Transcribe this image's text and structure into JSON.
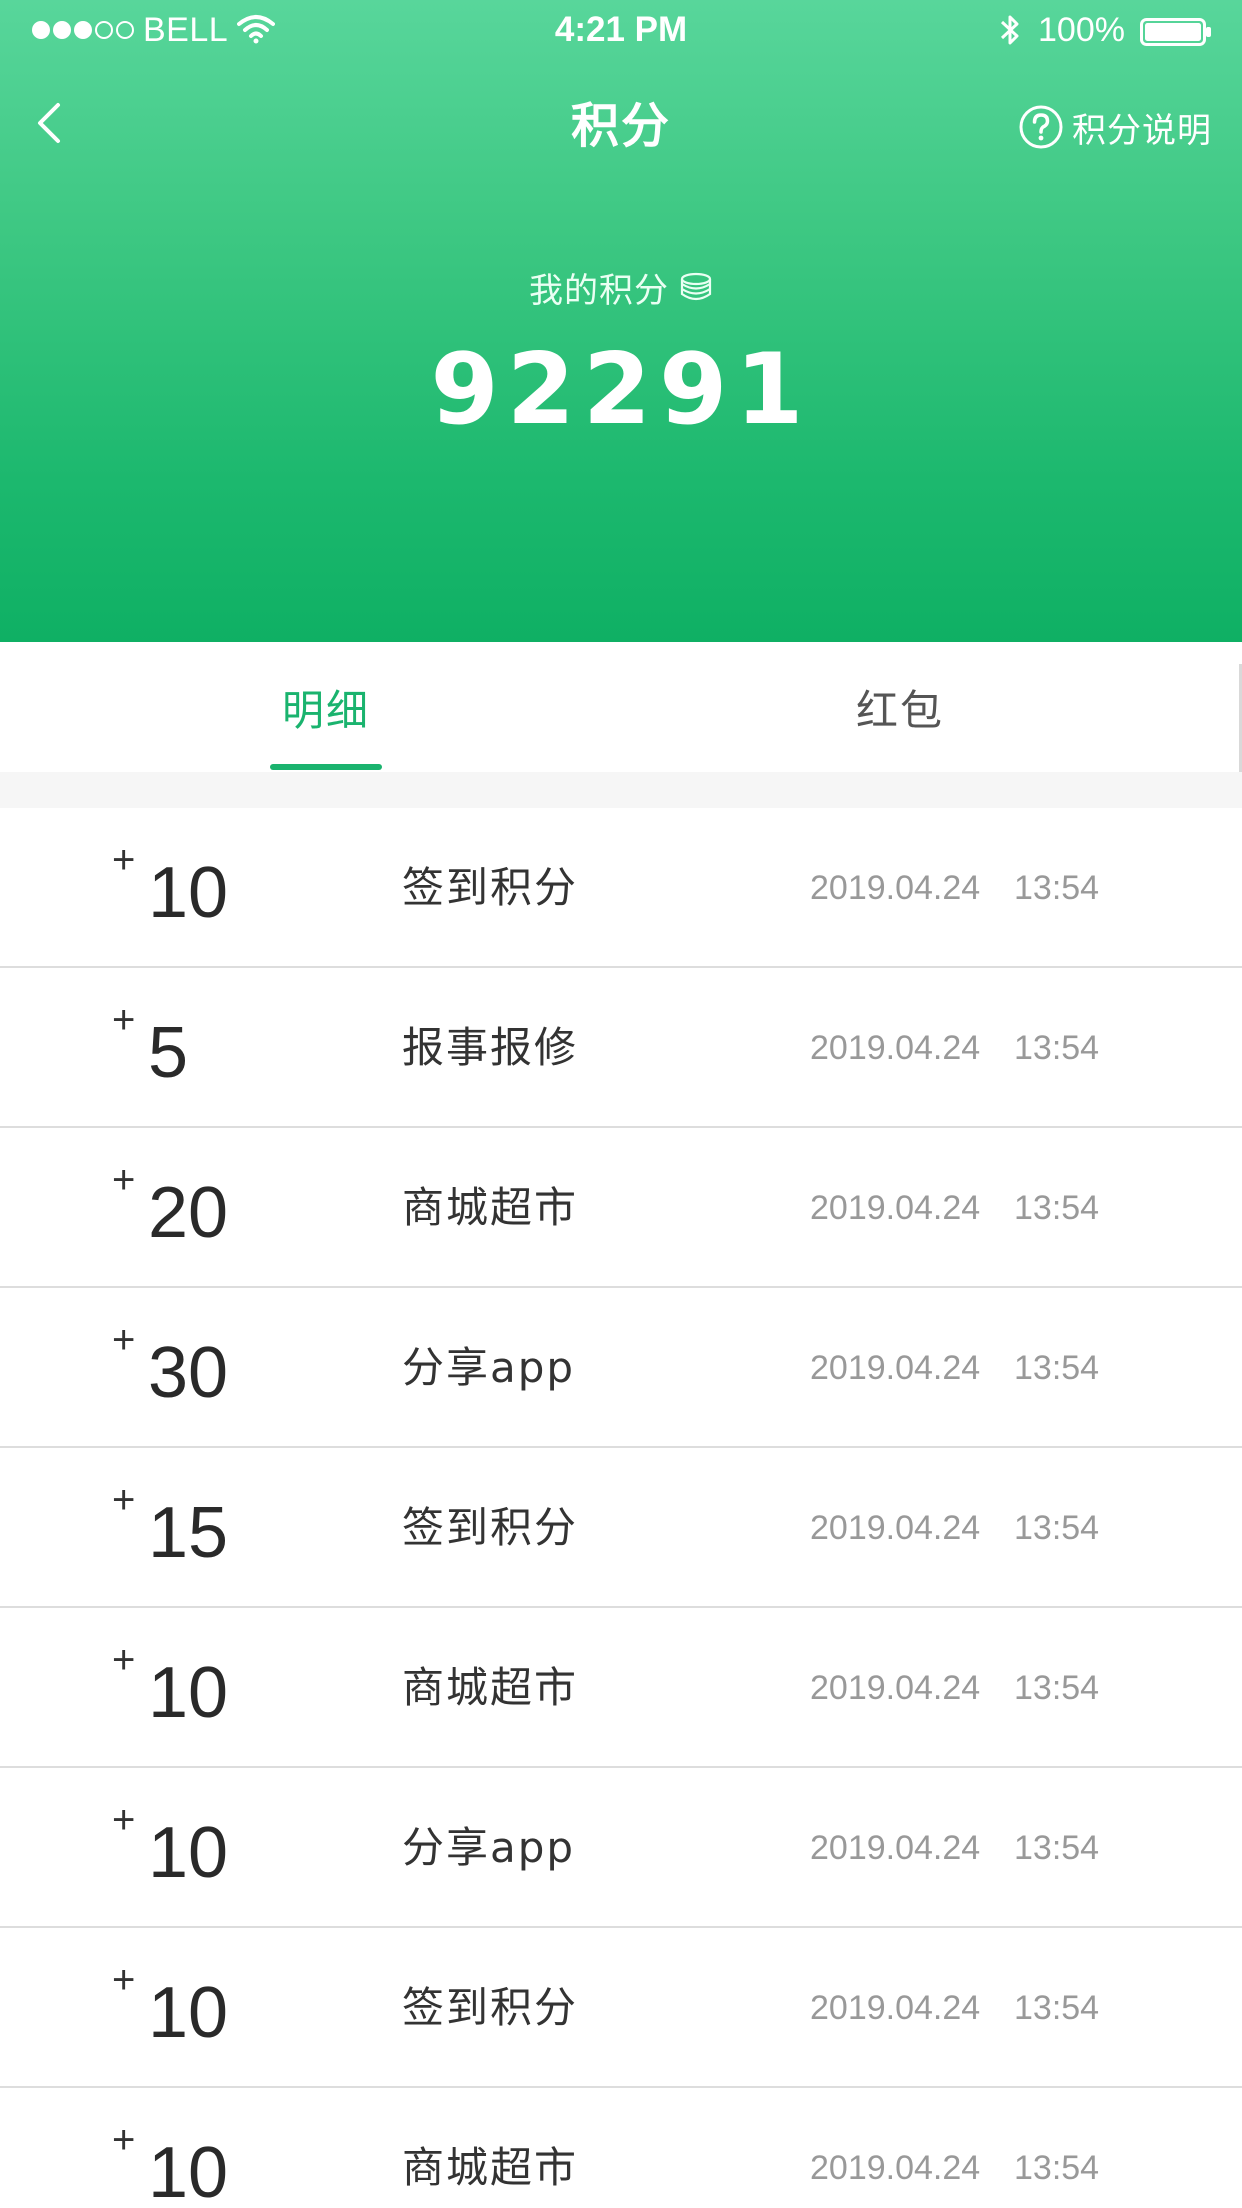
{
  "status_bar": {
    "carrier": "BELL",
    "time": "4:21 PM",
    "battery": "100%"
  },
  "nav": {
    "title": "积分",
    "help_label": "积分说明"
  },
  "points": {
    "caption": "我的积分",
    "value": "92291"
  },
  "tabs": [
    {
      "label": "明细",
      "active": true
    },
    {
      "label": "红包",
      "active": false
    }
  ],
  "records": [
    {
      "sign": "+",
      "amount": "10",
      "title": "签到积分",
      "date": "2019.04.24",
      "time": "13:54"
    },
    {
      "sign": "+",
      "amount": "5",
      "title": "报事报修",
      "date": "2019.04.24",
      "time": "13:54"
    },
    {
      "sign": "+",
      "amount": "20",
      "title": "商城超市",
      "date": "2019.04.24",
      "time": "13:54"
    },
    {
      "sign": "+",
      "amount": "30",
      "title": "分享app",
      "date": "2019.04.24",
      "time": "13:54"
    },
    {
      "sign": "+",
      "amount": "15",
      "title": "签到积分",
      "date": "2019.04.24",
      "time": "13:54"
    },
    {
      "sign": "+",
      "amount": "10",
      "title": "商城超市",
      "date": "2019.04.24",
      "time": "13:54"
    },
    {
      "sign": "+",
      "amount": "10",
      "title": "分享app",
      "date": "2019.04.24",
      "time": "13:54"
    },
    {
      "sign": "+",
      "amount": "10",
      "title": "签到积分",
      "date": "2019.04.24",
      "time": "13:54"
    },
    {
      "sign": "+",
      "amount": "10",
      "title": "商城超市",
      "date": "2019.04.24",
      "time": "13:54"
    }
  ],
  "icons": {
    "signal": "signal-dots-icon",
    "wifi": "wifi-icon",
    "bluetooth": "bluetooth-icon",
    "battery": "battery-icon",
    "back": "back-chevron-icon",
    "help": "question-circle-icon",
    "coins": "coin-stack-icon"
  },
  "colors": {
    "header_top": "#58d69b",
    "header_bottom": "#0fb064",
    "accent": "#1ab36e",
    "text_primary": "#333333",
    "text_secondary": "#999999",
    "divider": "#dddddd",
    "separator_band": "#f6f6f6"
  }
}
